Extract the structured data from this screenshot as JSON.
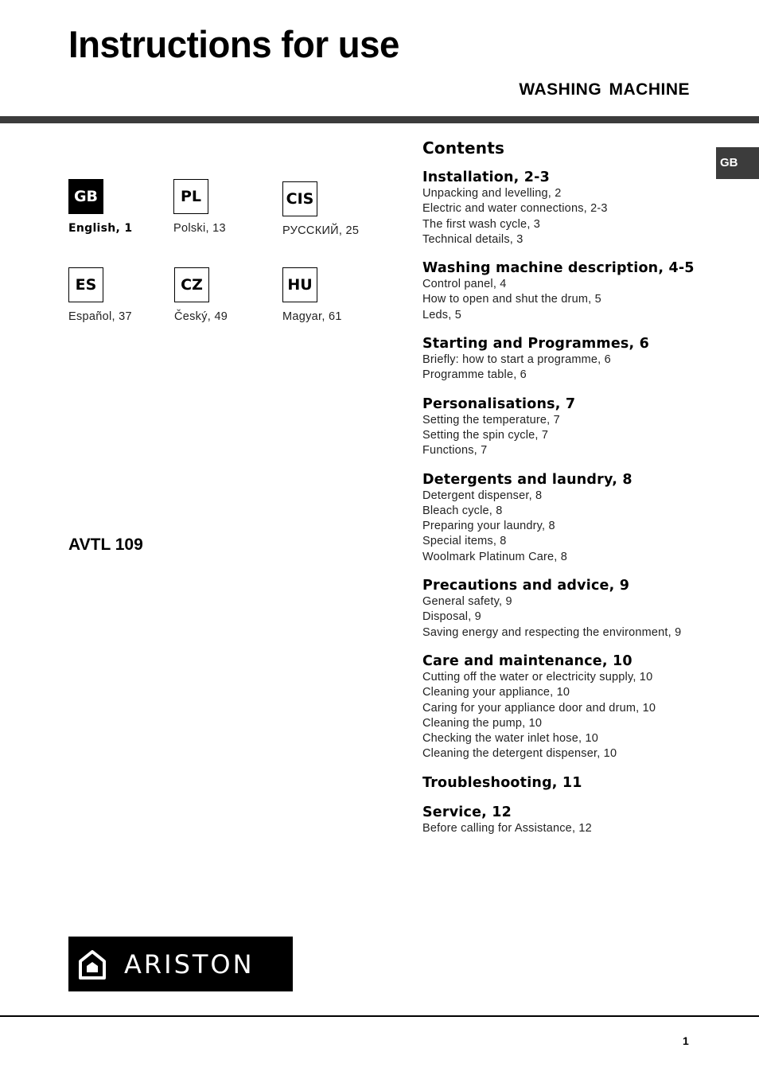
{
  "header": {
    "title": "Instructions for use",
    "subtitle": "WASHING MACHINE",
    "side_tab": "GB"
  },
  "languages": [
    {
      "code": "GB",
      "label": "English, 1",
      "active": true
    },
    {
      "code": "PL",
      "label": "Polski, 13",
      "active": false
    },
    {
      "code": "CIS",
      "label": "РУССКИЙ, 25",
      "active": false
    },
    {
      "code": "ES",
      "label": "Español, 37",
      "active": false
    },
    {
      "code": "CZ",
      "label": "Český,  49",
      "active": false
    },
    {
      "code": "HU",
      "label": "Magyar, 61",
      "active": false
    }
  ],
  "model": "AVTL 109",
  "contents": {
    "heading": "Contents",
    "sections": [
      {
        "title": "Installation, 2-3",
        "items": [
          "Unpacking and levelling, 2",
          "Electric and water connections, 2-3",
          "The first wash cycle, 3",
          "Technical details, 3"
        ]
      },
      {
        "title": "Washing machine description, 4-5",
        "items": [
          "Control panel, 4",
          "How to open and shut the drum, 5",
          "Leds, 5"
        ]
      },
      {
        "title": "Starting and Programmes, 6",
        "items": [
          "Briefly: how to start a programme, 6",
          "Programme table, 6"
        ]
      },
      {
        "title": "Personalisations, 7",
        "items": [
          "Setting the temperature, 7",
          "Setting the spin cycle, 7",
          "Functions, 7"
        ]
      },
      {
        "title": "Detergents and laundry, 8",
        "items": [
          "Detergent dispenser, 8",
          "Bleach cycle, 8",
          "Preparing your laundry, 8",
          "Special items, 8",
          "Woolmark Platinum Care, 8"
        ]
      },
      {
        "title": "Precautions and advice, 9",
        "items": [
          "General safety, 9",
          "Disposal, 9",
          "Saving energy and respecting the environment, 9"
        ]
      },
      {
        "title": "Care and maintenance, 10",
        "items": [
          "Cutting off the water or electricity supply, 10",
          "Cleaning your appliance, 10",
          "Caring for your appliance door and drum, 10",
          "Cleaning the pump, 10",
          "Checking the water inlet hose, 10",
          "Cleaning the detergent dispenser, 10"
        ]
      },
      {
        "title": "Troubleshooting, 11",
        "items": []
      },
      {
        "title": "Service, 12",
        "items": [
          "Before calling for Assistance, 12"
        ]
      }
    ]
  },
  "logo": {
    "brand": "ARISTON",
    "icon": "house-icon"
  },
  "footer": {
    "page_number": "1"
  }
}
